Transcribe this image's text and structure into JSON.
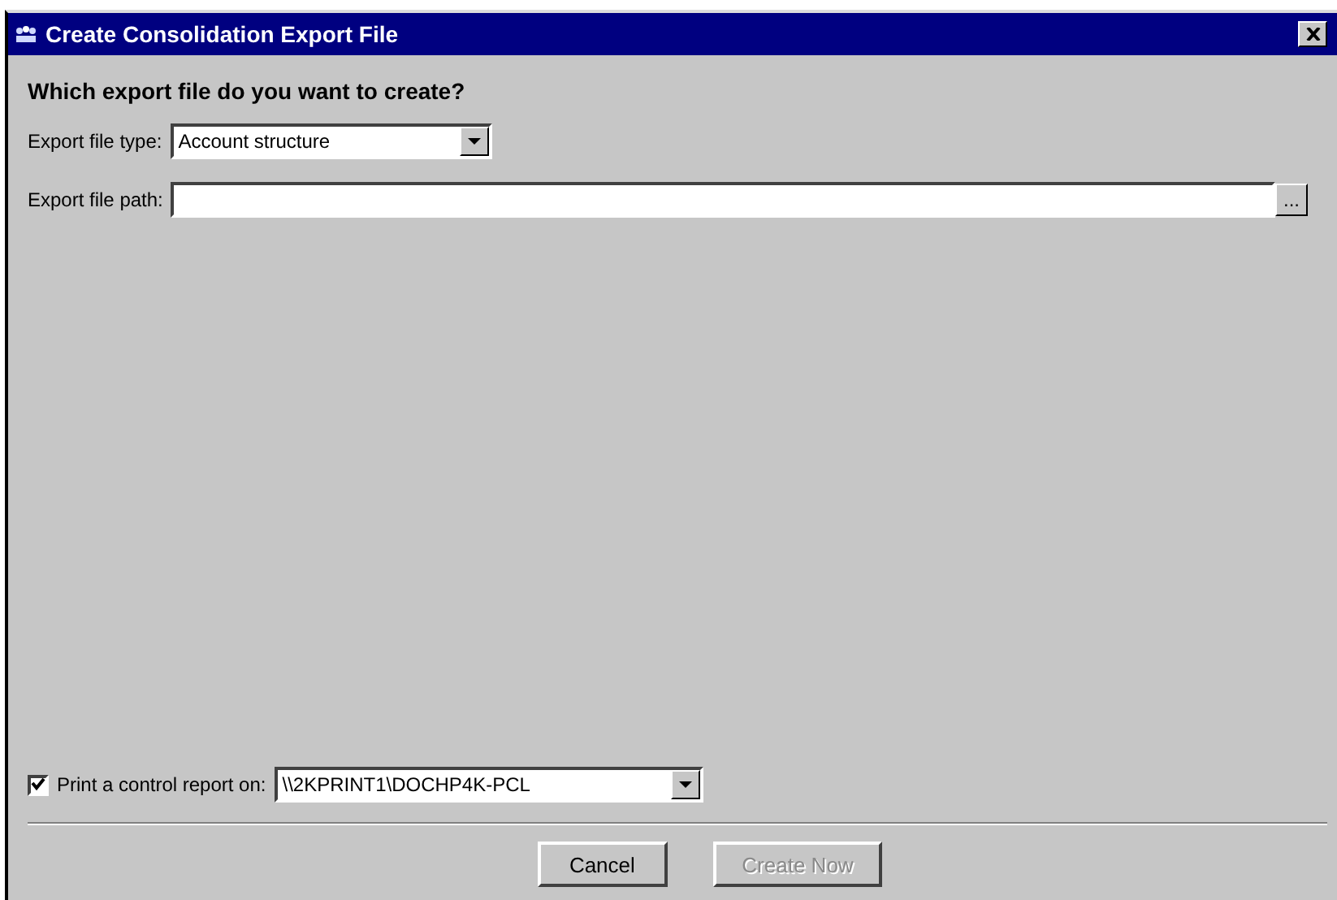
{
  "window": {
    "title": "Create Consolidation Export File"
  },
  "heading": "Which export file do you want to create?",
  "file_type": {
    "label": "Export file type:",
    "value": "Account structure"
  },
  "file_path": {
    "label": "Export file path:",
    "browse": "..."
  },
  "control_report": {
    "label": "Print a control report on:",
    "checked": true,
    "printer": "\\\\2KPRINT1\\DOCHP4K-PCL"
  },
  "buttons": [
    {
      "label": "Cancel",
      "disabled": false
    },
    {
      "label": "Create Now",
      "disabled": true
    }
  ]
}
